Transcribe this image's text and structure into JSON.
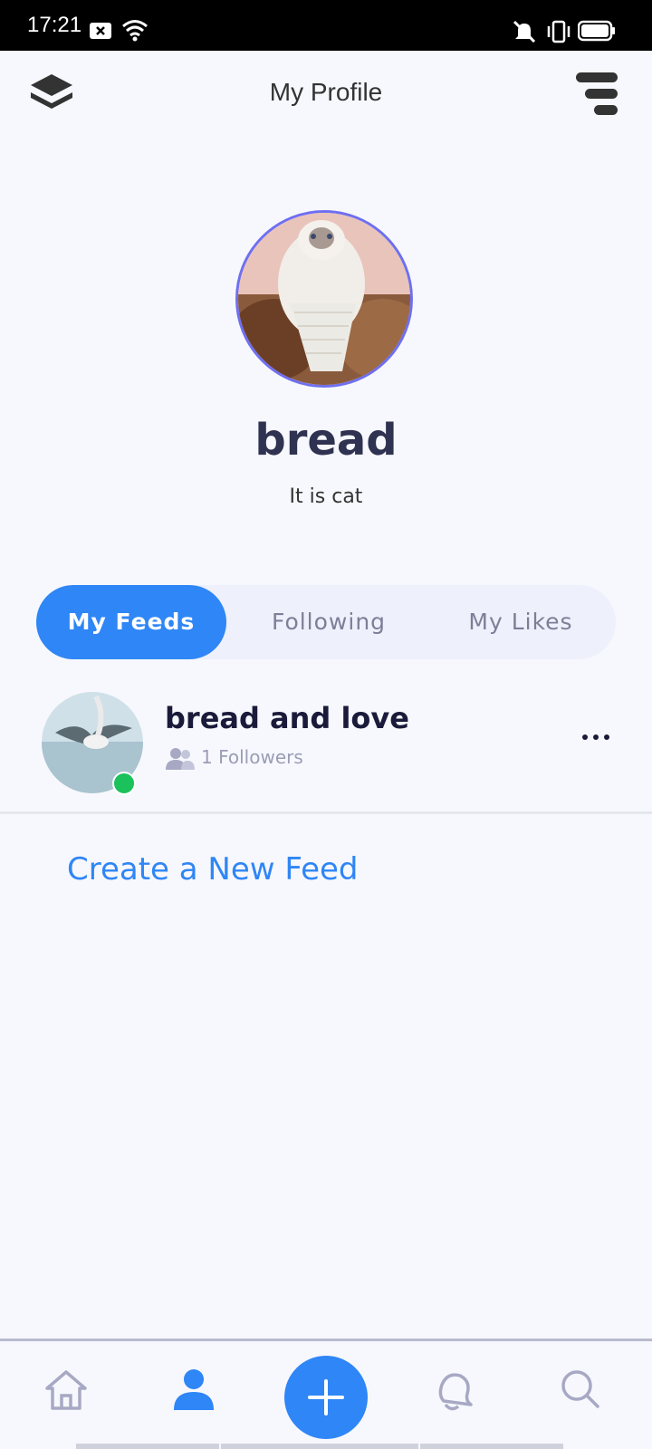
{
  "status_bar": {
    "time": "17:21"
  },
  "header": {
    "title": "My Profile",
    "logo_icon": "layers-icon",
    "menu_icon": "menu-icon"
  },
  "profile": {
    "name": "bread",
    "bio": "It is cat"
  },
  "tabs": [
    {
      "label": "My Feeds",
      "active": true
    },
    {
      "label": "Following",
      "active": false
    },
    {
      "label": "My Likes",
      "active": false
    }
  ],
  "feeds": [
    {
      "name": "bread and love",
      "followers": "1 Followers",
      "online": true
    }
  ],
  "create_feed_label": "Create a New Feed",
  "bottom_nav": [
    "home-icon",
    "profile-icon",
    "add-icon",
    "bell-icon",
    "search-icon"
  ],
  "colors": {
    "accent": "#2f86f6",
    "online": "#1bc15b",
    "background": "#f7f8fd"
  }
}
